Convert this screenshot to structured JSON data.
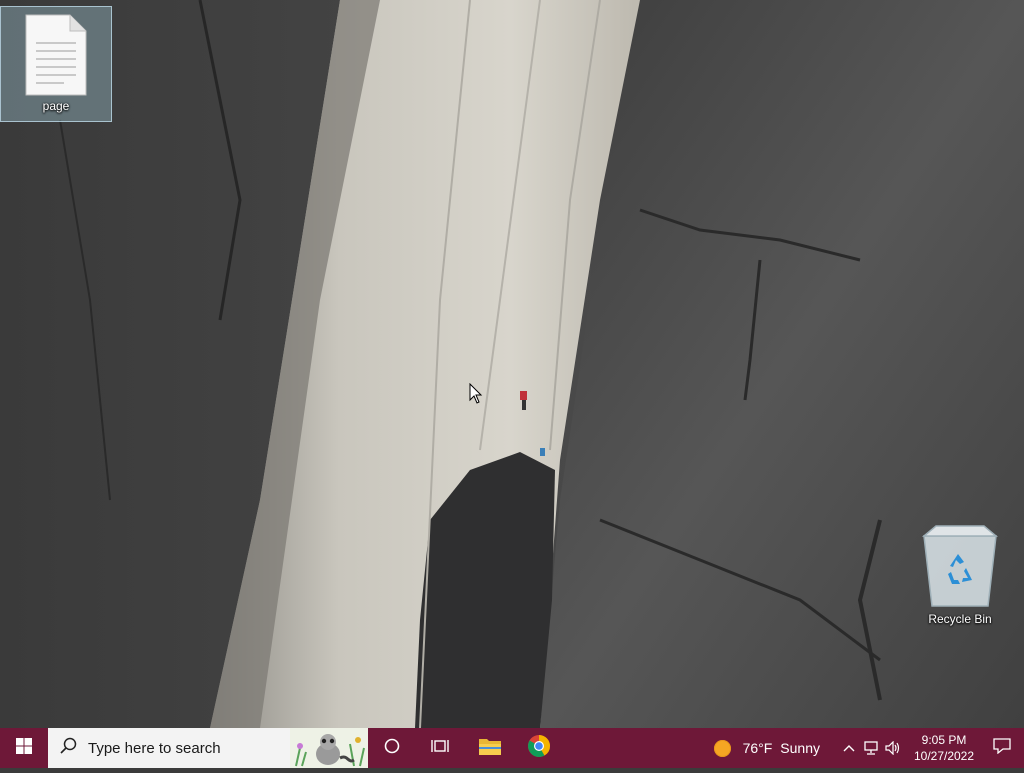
{
  "desktop": {
    "icons": [
      {
        "label": "page",
        "icon": "text-document-icon"
      },
      {
        "label": "Recycle Bin",
        "icon": "recycle-bin-icon"
      }
    ]
  },
  "taskbar": {
    "search_placeholder": "Type here to search",
    "weather": {
      "temp": "76°F",
      "condition": "Sunny"
    },
    "clock": {
      "time": "9:05 PM",
      "date": "10/27/2022"
    },
    "accent_color": "#6e1838"
  }
}
